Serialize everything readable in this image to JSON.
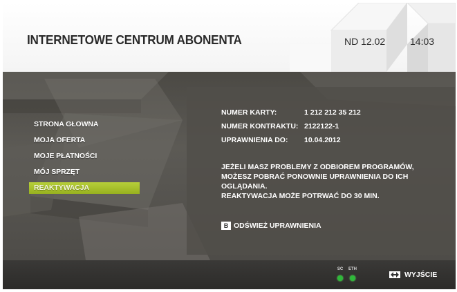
{
  "header": {
    "title": "INTERNETOWE CENTRUM ABONENTA",
    "date": "ND 12.02",
    "time": "14:03"
  },
  "menu": {
    "items": [
      {
        "label": "STRONA GŁOWNA"
      },
      {
        "label": "MOJA OFERTA"
      },
      {
        "label": "MOJE PŁATNOŚCI"
      },
      {
        "label": "MÓJ SPRZĘT"
      },
      {
        "label": "REAKTYWACJA",
        "active": true
      }
    ]
  },
  "info": {
    "card_label": "NUMER KARTY:",
    "card_value": "1 212 212 35 212",
    "contract_label": "NUMER KONTRAKTU:",
    "contract_value": "2122122-1",
    "rights_label": "UPRAWNIENIA DO:",
    "rights_value": "10.04.2012"
  },
  "message": {
    "line1": "JEŻELI MASZ PROBLEMY Z ODBIOREM PROGRAMÓW,",
    "line2": "MOŻESZ POBRAĆ PONOWNIE UPRAWNIENIA DO ICH",
    "line3": "OGLĄDANIA.",
    "line4": "REAKTYWACJA MOŻE POTRWAĆ DO 30 MIN."
  },
  "actions": {
    "refresh_key": "B",
    "refresh_label": "ODŚWIEŻ UPRAWNIENIA"
  },
  "footer": {
    "indicator_sc": "SC",
    "indicator_eth": "ETH",
    "exit_label": "WYJŚCIE"
  },
  "colors": {
    "active_item": "#a8c22b",
    "indicator_green": "#2fb83a"
  },
  "icons": {
    "exit": "exit-arrow-icon",
    "status": "status-dot-icon"
  }
}
